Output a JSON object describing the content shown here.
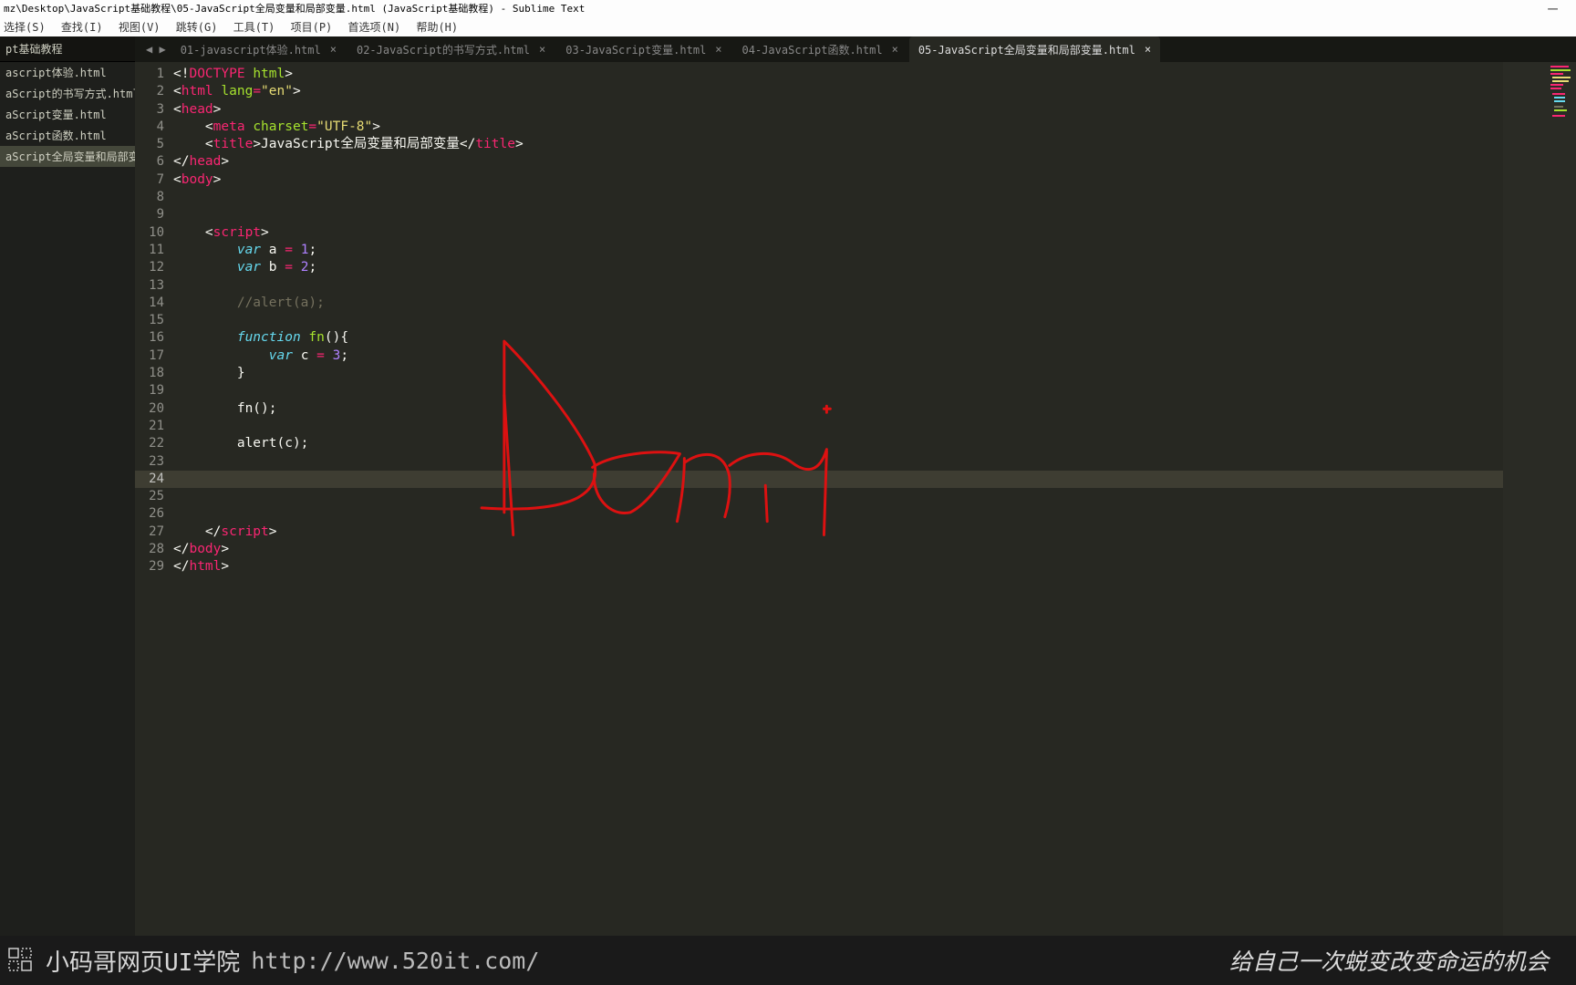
{
  "window": {
    "title": "mz\\Desktop\\JavaScript基础教程\\05-JavaScript全局变量和局部变量.html (JavaScript基础教程) - Sublime Text"
  },
  "menu": {
    "items": [
      "选择(S)",
      "查找(I)",
      "视图(V)",
      "跳转(G)",
      "工具(T)",
      "项目(P)",
      "首选项(N)",
      "帮助(H)"
    ]
  },
  "sidebar": {
    "header": "pt基础教程",
    "items": [
      "ascript体验.html",
      "aScript的书写方式.html",
      "aScript变量.html",
      "aScript函数.html",
      "aScript全局变量和局部变量.html"
    ],
    "active_index": 4
  },
  "tabs": {
    "items": [
      "01-javascript体验.html",
      "02-JavaScript的书写方式.html",
      "03-JavaScript变量.html",
      "04-JavaScript函数.html",
      "05-JavaScript全局变量和局部变量.html"
    ],
    "active_index": 4
  },
  "code": {
    "lines": [
      {
        "n": 1,
        "seg": [
          [
            "c-punct",
            "<!"
          ],
          [
            "c-doctag",
            "DOCTYPE"
          ],
          [
            "c-punct",
            " "
          ],
          [
            "c-attr",
            "html"
          ],
          [
            "c-punct",
            ">"
          ]
        ]
      },
      {
        "n": 2,
        "seg": [
          [
            "c-punct",
            "<"
          ],
          [
            "c-tag",
            "html"
          ],
          [
            "c-punct",
            " "
          ],
          [
            "c-attr",
            "lang"
          ],
          [
            "c-op",
            "="
          ],
          [
            "c-str",
            "\"en\""
          ],
          [
            "c-punct",
            ">"
          ]
        ]
      },
      {
        "n": 3,
        "seg": [
          [
            "c-punct",
            "<"
          ],
          [
            "c-tag",
            "head"
          ],
          [
            "c-punct",
            ">"
          ]
        ]
      },
      {
        "n": 4,
        "seg": [
          [
            "c-punct",
            "    <"
          ],
          [
            "c-tag",
            "meta"
          ],
          [
            "c-punct",
            " "
          ],
          [
            "c-attr",
            "charset"
          ],
          [
            "c-op",
            "="
          ],
          [
            "c-str",
            "\"UTF-8\""
          ],
          [
            "c-punct",
            ">"
          ]
        ]
      },
      {
        "n": 5,
        "seg": [
          [
            "c-punct",
            "    <"
          ],
          [
            "c-tag",
            "title"
          ],
          [
            "c-punct",
            ">JavaScript全局变量和局部变量</"
          ],
          [
            "c-tag",
            "title"
          ],
          [
            "c-punct",
            ">"
          ]
        ]
      },
      {
        "n": 6,
        "seg": [
          [
            "c-punct",
            "</"
          ],
          [
            "c-tag",
            "head"
          ],
          [
            "c-punct",
            ">"
          ]
        ]
      },
      {
        "n": 7,
        "seg": [
          [
            "c-punct",
            "<"
          ],
          [
            "c-tag",
            "body"
          ],
          [
            "c-punct",
            ">"
          ]
        ]
      },
      {
        "n": 8,
        "seg": []
      },
      {
        "n": 9,
        "seg": []
      },
      {
        "n": 10,
        "seg": [
          [
            "c-punct",
            "    <"
          ],
          [
            "c-tag",
            "script"
          ],
          [
            "c-punct",
            ">"
          ]
        ]
      },
      {
        "n": 11,
        "seg": [
          [
            "c-punct",
            "        "
          ],
          [
            "c-keyword",
            "var"
          ],
          [
            "c-punct",
            " a "
          ],
          [
            "c-op",
            "="
          ],
          [
            "c-punct",
            " "
          ],
          [
            "c-num",
            "1"
          ],
          [
            "c-punct",
            ";"
          ]
        ]
      },
      {
        "n": 12,
        "seg": [
          [
            "c-punct",
            "        "
          ],
          [
            "c-keyword",
            "var"
          ],
          [
            "c-punct",
            " b "
          ],
          [
            "c-op",
            "="
          ],
          [
            "c-punct",
            " "
          ],
          [
            "c-num",
            "2"
          ],
          [
            "c-punct",
            ";"
          ]
        ]
      },
      {
        "n": 13,
        "seg": []
      },
      {
        "n": 14,
        "seg": [
          [
            "c-punct",
            "        "
          ],
          [
            "c-comment",
            "//alert(a);"
          ]
        ]
      },
      {
        "n": 15,
        "seg": []
      },
      {
        "n": 16,
        "seg": [
          [
            "c-punct",
            "        "
          ],
          [
            "c-funcdecl",
            "function"
          ],
          [
            "c-punct",
            " "
          ],
          [
            "c-funcname",
            "fn"
          ],
          [
            "c-punct",
            "(){"
          ]
        ]
      },
      {
        "n": 17,
        "seg": [
          [
            "c-punct",
            "            "
          ],
          [
            "c-keyword",
            "var"
          ],
          [
            "c-punct",
            " c "
          ],
          [
            "c-op",
            "="
          ],
          [
            "c-punct",
            " "
          ],
          [
            "c-num",
            "3"
          ],
          [
            "c-punct",
            ";"
          ]
        ]
      },
      {
        "n": 18,
        "seg": [
          [
            "c-punct",
            "        }"
          ]
        ]
      },
      {
        "n": 19,
        "seg": []
      },
      {
        "n": 20,
        "seg": [
          [
            "c-punct",
            "        fn();"
          ]
        ]
      },
      {
        "n": 21,
        "seg": []
      },
      {
        "n": 22,
        "seg": [
          [
            "c-punct",
            "        alert(c);"
          ]
        ]
      },
      {
        "n": 23,
        "seg": []
      },
      {
        "n": 24,
        "seg": [],
        "active": true
      },
      {
        "n": 25,
        "seg": []
      },
      {
        "n": 26,
        "seg": []
      },
      {
        "n": 27,
        "seg": [
          [
            "c-punct",
            "    </"
          ],
          [
            "c-tag",
            "script"
          ],
          [
            "c-punct",
            ">"
          ]
        ]
      },
      {
        "n": 28,
        "seg": [
          [
            "c-punct",
            "</"
          ],
          [
            "c-tag",
            "body"
          ],
          [
            "c-punct",
            ">"
          ]
        ]
      },
      {
        "n": 29,
        "seg": [
          [
            "c-punct",
            "</"
          ],
          [
            "c-tag",
            "html"
          ],
          [
            "c-punct",
            ">"
          ]
        ]
      }
    ]
  },
  "footer": {
    "brand": "小码哥网页UI学院",
    "url": "http://www.520it.com/",
    "slogan": "给自己一次蜕变改变命运的机会"
  },
  "annotation_label": "Dom"
}
